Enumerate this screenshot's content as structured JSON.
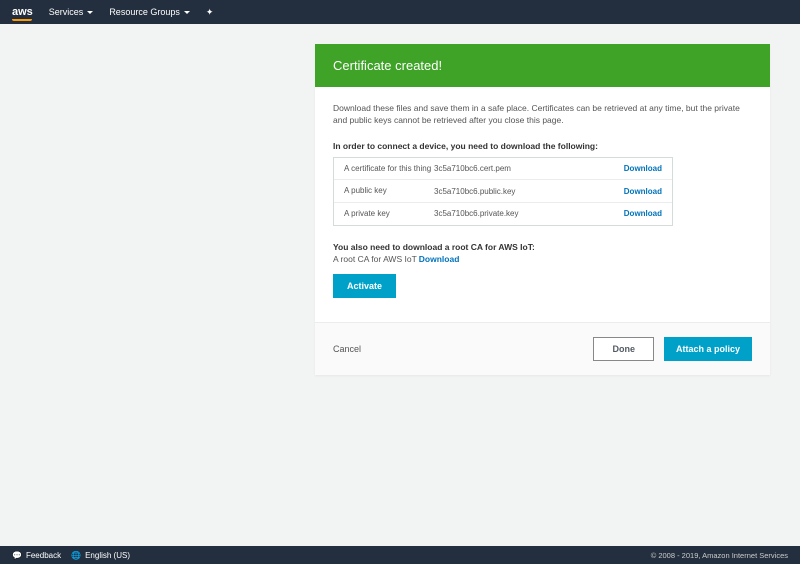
{
  "nav": {
    "logo": "aws",
    "services": "Services",
    "resource_groups": "Resource Groups"
  },
  "panel": {
    "title": "Certificate created!",
    "description": "Download these files and save them in a safe place. Certificates can be retrieved at any time, but the private and public keys cannot be retrieved after you close this page.",
    "download_intro": "In order to connect a device, you need to download the following:",
    "rows": [
      {
        "label": "A certificate for this thing",
        "file": "3c5a710bc6.cert.pem",
        "action": "Download"
      },
      {
        "label": "A public key",
        "file": "3c5a710bc6.public.key",
        "action": "Download"
      },
      {
        "label": "A private key",
        "file": "3c5a710bc6.private.key",
        "action": "Download"
      }
    ],
    "root_ca_title": "You also need to download a root CA for AWS IoT:",
    "root_ca_text": "A root CA for AWS IoT",
    "root_ca_download": "Download",
    "activate": "Activate"
  },
  "footer": {
    "cancel": "Cancel",
    "done": "Done",
    "attach": "Attach a policy"
  },
  "bottom": {
    "feedback": "Feedback",
    "language": "English (US)",
    "copyright": "© 2008 - 2019, Amazon Internet Services"
  }
}
